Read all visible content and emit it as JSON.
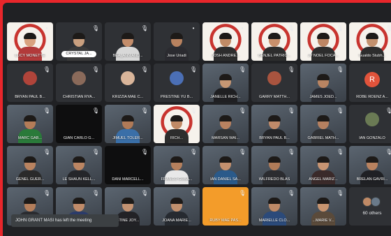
{
  "rows": [
    [
      {
        "name": "LUCY MONETTE",
        "bg": "frame-bg",
        "kind": "photo",
        "skin": "#d9a27f",
        "shirt": "#b23a3a",
        "mic": "•"
      },
      {
        "name": "CRYSTAL JA...",
        "bg": "dark",
        "kind": "photo",
        "skin": "#caa07f",
        "shirt": "#3b3b3b",
        "pill": true,
        "mic": "🎙"
      },
      {
        "name": "BEA_ANN AND...",
        "bg": "dark",
        "kind": "photo",
        "skin": "#c38d6b",
        "shirt": "#d8d8d8",
        "mic": "🎙"
      },
      {
        "name": "Jose Uriadi",
        "bg": "dark",
        "kind": "photo",
        "skin": "#b8825f",
        "shirt": "#2b2b30",
        "mic": "•"
      },
      {
        "name": "JOSH ANDRE...",
        "bg": "frame-bg",
        "kind": "photo",
        "skin": "#c08b66",
        "shirt": "#2d2d2d",
        "mic": "•"
      },
      {
        "name": "BENJEL PATRIC...",
        "bg": "frame-bg",
        "kind": "photo",
        "skin": "#c8906c",
        "shirt": "#2d2d2d",
        "mic": "🎙"
      },
      {
        "name": "JV NOEL FOCA...",
        "bg": "frame-bg",
        "kind": "photo",
        "skin": "#bd8664",
        "shirt": "#2d2d2d",
        "mic": "🎙"
      },
      {
        "name": "Gualdo Stubh...",
        "bg": "frame-bg",
        "kind": "photo",
        "skin": "#c3916e",
        "shirt": "#2d2d2d",
        "mic": "🎙"
      }
    ],
    [
      {
        "name": "BRYAN PAUL B...",
        "bg": "dark",
        "kind": "avatar",
        "color": "#b0443a",
        "mic": "🎙"
      },
      {
        "name": "CHRISTIAN RYA...",
        "bg": "dark",
        "kind": "avatar",
        "color": "#8a6a5a",
        "mic": "🎙"
      },
      {
        "name": "KRIZZIA MAE C...",
        "bg": "dark",
        "kind": "avatar",
        "color": "#d9b59a",
        "mic": "🎙"
      },
      {
        "name": "PRESTINE YU B...",
        "bg": "dark",
        "kind": "avatar",
        "color": "#4b6fb5",
        "mic": "🎙"
      },
      {
        "name": "JANELLE RICH...",
        "bg": "photo-bg",
        "kind": "photo",
        "skin": "#c59673",
        "shirt": "#1f1f22",
        "mic": "🎙"
      },
      {
        "name": "GARRY MATTH...",
        "bg": "dark",
        "kind": "avatar",
        "color": "#a9543f",
        "mic": "🎙"
      },
      {
        "name": "JAMES JOED...",
        "bg": "photo-bg",
        "kind": "photo",
        "skin": "#b98462",
        "shirt": "#2a2c33",
        "mic": "🎙"
      },
      {
        "name": "ROBE ROENZ A...",
        "bg": "dark",
        "kind": "letter",
        "letter": "R",
        "mic": ""
      }
    ],
    [
      {
        "name": "MARC GAB...",
        "bg": "photo-bg",
        "kind": "photo",
        "skin": "#b47c58",
        "shirt": "#2a7a3a",
        "mic": "🎙"
      },
      {
        "name": "GIAN CARLO G...",
        "bg": "black",
        "kind": "none",
        "mic": "🎙"
      },
      {
        "name": "JIMUEL TOLER...",
        "bg": "photo-bg",
        "kind": "photo",
        "skin": "#b07a57",
        "shirt": "#3a6fa8",
        "mic": "🎙"
      },
      {
        "name": "RICH...",
        "bg": "frame-bg",
        "kind": "photo",
        "skin": "#c08a66",
        "shirt": "#2d2d2d",
        "mic": "🎙"
      },
      {
        "name": "MARSAN WAI...",
        "bg": "photo-bg",
        "kind": "photo",
        "skin": "#b98260",
        "shirt": "#323436",
        "mic": "🎙"
      },
      {
        "name": "BRYAN PAUL B...",
        "bg": "photo-bg",
        "kind": "photo",
        "skin": "#c08a69",
        "shirt": "#252629",
        "mic": "🎙"
      },
      {
        "name": "GABRIEL MATH...",
        "bg": "photo-bg",
        "kind": "photo",
        "skin": "#b58060",
        "shirt": "#303236",
        "mic": "🎙"
      },
      {
        "name": "IAN GONZALO",
        "bg": "dark",
        "kind": "avatar",
        "color": "#6a7a54",
        "mic": "🎙"
      }
    ],
    [
      {
        "name": "GENEL GUER...",
        "bg": "photo-bg",
        "kind": "photo",
        "skin": "#b98360",
        "shirt": "#2a2a2a",
        "mic": "🎙"
      },
      {
        "name": "LE SHAUN KELL...",
        "bg": "photo-bg",
        "kind": "photo",
        "skin": "#bb8562",
        "shirt": "#25262a",
        "mic": "🎙"
      },
      {
        "name": "DANI MARCELL...",
        "bg": "black",
        "kind": "none",
        "mic": "🎙"
      },
      {
        "name": "FRANCO GUBA...",
        "bg": "photo-bg",
        "kind": "photo",
        "skin": "#b5805d",
        "shirt": "#e8e8e8",
        "mic": "🎙"
      },
      {
        "name": "IAN DANIEL SA...",
        "bg": "photo-bg",
        "kind": "photo",
        "skin": "#c3906e",
        "shirt": "#2a5a8a",
        "mic": "🎙"
      },
      {
        "name": "WILFREDO BLAS",
        "bg": "photo-bg",
        "kind": "photo",
        "skin": "#b07b58",
        "shirt": "#2b2c30",
        "mic": "🎙"
      },
      {
        "name": "ANGEL MARIZ...",
        "bg": "photo-bg",
        "kind": "photo",
        "skin": "#c79472",
        "shirt": "#3a2a2a",
        "mic": "🎙"
      },
      {
        "name": "BRELAN GAVRI...",
        "bg": "photo-bg",
        "kind": "photo",
        "skin": "#b9825f",
        "shirt": "#1f2024",
        "mic": "🎙"
      }
    ],
    [
      {
        "name": "JOHN GRANT MASI",
        "bg": "photo-bg",
        "kind": "photo",
        "skin": "#b47e5b",
        "shirt": "#2a2b2f",
        "mic": "🎙"
      },
      {
        "name": "",
        "bg": "photo-bg",
        "kind": "photo",
        "skin": "#c08b69",
        "shirt": "#2b3b6a",
        "mic": "🎙"
      },
      {
        "name": "STINE JOY...",
        "bg": "photo-bg",
        "kind": "photo",
        "skin": "#c39271",
        "shirt": "#222226",
        "mic": "🎙"
      },
      {
        "name": "JOANA MARIE...",
        "bg": "photo-bg",
        "kind": "photo",
        "skin": "#c08f6d",
        "shirt": "#262a30",
        "mic": "🎙"
      },
      {
        "name": "RUBY MAE PAS...",
        "bg": "orange",
        "kind": "none",
        "mic": "🎙"
      },
      {
        "name": "MARIELLE CLO...",
        "bg": "photo-bg",
        "kind": "photo",
        "skin": "#bd8966",
        "shirt": "#2b4a7a",
        "mic": "🎙"
      },
      {
        "name": "...MARIE V...",
        "bg": "photo-bg",
        "kind": "photo",
        "skin": "#c7946f",
        "shirt": "#5a4a3a",
        "mic": "🎙"
      },
      {
        "name": "60 others",
        "bg": "dark",
        "kind": "others",
        "mic": ""
      }
    ]
  ],
  "toast": "JOHN GRANT MASI has left the meeting"
}
